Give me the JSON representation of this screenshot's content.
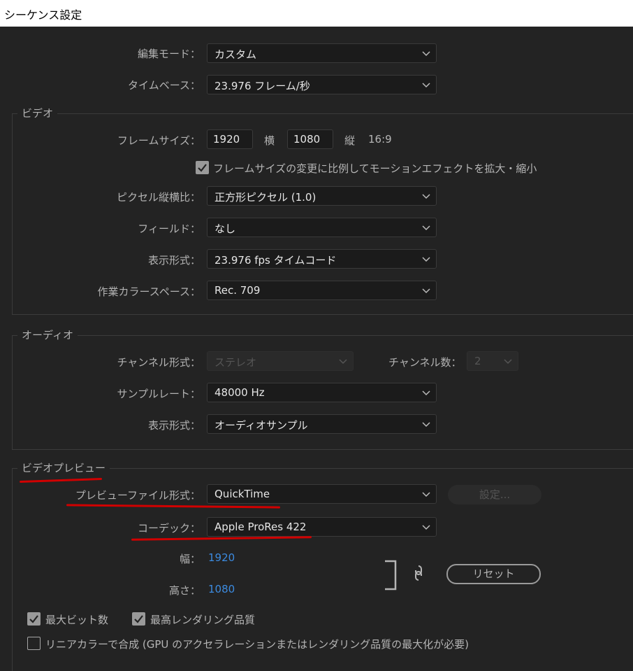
{
  "window": {
    "title": "シーケンス設定"
  },
  "top": {
    "edit_mode": {
      "label": "編集モード：",
      "value": "カスタム"
    },
    "timebase": {
      "label": "タイムベース：",
      "value": "23.976  フレーム/秒"
    }
  },
  "video": {
    "title": "ビデオ",
    "frame_size": {
      "label": "フレームサイズ：",
      "width": "1920",
      "width_label": "横",
      "height": "1080",
      "height_label": "縦",
      "aspect": "16:9"
    },
    "scale_checkbox": {
      "checked": true,
      "label": "フレームサイズの変更に比例してモーションエフェクトを拡大・縮小"
    },
    "pixel_aspect": {
      "label": "ピクセル縦横比：",
      "value": "正方形ピクセル (1.0)"
    },
    "fields": {
      "label": "フィールド：",
      "value": "なし"
    },
    "display_format": {
      "label": "表示形式：",
      "value": "23.976  fps タイムコード"
    },
    "color_space": {
      "label": "作業カラースペース：",
      "value": "Rec. 709"
    }
  },
  "audio": {
    "title": "オーディオ",
    "channel_format": {
      "label": "チャンネル形式：",
      "value": "ステレオ"
    },
    "channel_count": {
      "label": "チャンネル数：",
      "value": "2"
    },
    "sample_rate": {
      "label": "サンプルレート：",
      "value": "48000 Hz"
    },
    "display_format": {
      "label": "表示形式：",
      "value": "オーディオサンプル"
    }
  },
  "preview": {
    "title": "ビデオプレビュー",
    "file_format": {
      "label": "プレビューファイル形式：",
      "value": "QuickTime"
    },
    "settings_button": "設定...",
    "codec": {
      "label": "コーデック：",
      "value": "Apple ProRes 422"
    },
    "width": {
      "label": "幅：",
      "value": "1920"
    },
    "height": {
      "label": "高さ：",
      "value": "1080"
    },
    "reset_button": "リセット",
    "max_bit_depth": {
      "checked": true,
      "label": "最大ビット数"
    },
    "max_render_quality": {
      "checked": true,
      "label": "最高レンダリング品質"
    },
    "linear_color": {
      "checked": false,
      "label": "リニアカラーで合成 (GPU のアクセラレーションまたはレンダリング品質の最大化が必要)"
    }
  },
  "colors": {
    "background": "#232323",
    "link_blue": "#3c8be0",
    "annotation_red": "#d10000"
  }
}
